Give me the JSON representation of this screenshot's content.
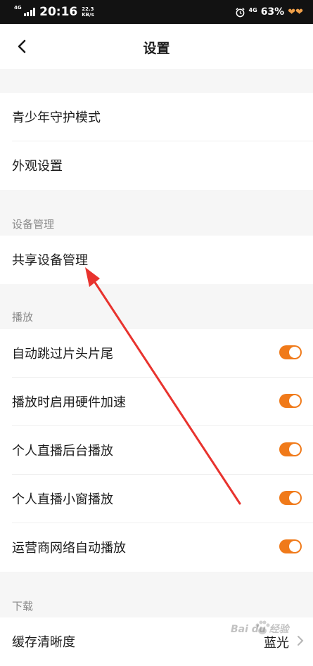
{
  "status_bar": {
    "network": "4G",
    "time": "20:16",
    "speed_value": "22.3",
    "speed_unit": "KB/s",
    "network_right": "4G",
    "battery": "63%"
  },
  "header": {
    "title": "设置"
  },
  "group1": {
    "items": [
      {
        "label": "青少年守护模式"
      },
      {
        "label": "外观设置"
      }
    ]
  },
  "device_section": {
    "title": "设备管理",
    "items": [
      {
        "label": "共享设备管理"
      }
    ]
  },
  "playback_section": {
    "title": "播放",
    "items": [
      {
        "label": "自动跳过片头片尾",
        "enabled": true
      },
      {
        "label": "播放时启用硬件加速",
        "enabled": true
      },
      {
        "label": "个人直播后台播放",
        "enabled": true
      },
      {
        "label": "个人直播小窗播放",
        "enabled": true
      },
      {
        "label": "运营商网络自动播放",
        "enabled": true
      }
    ]
  },
  "download_section": {
    "title": "下载",
    "items": [
      {
        "label": "缓存清晰度",
        "value": "蓝光"
      }
    ]
  },
  "colors": {
    "toggle_on": "#f07a1a",
    "annotation_arrow": "#e8332e"
  },
  "watermark": {
    "logo_text": "Bai du 经验"
  }
}
